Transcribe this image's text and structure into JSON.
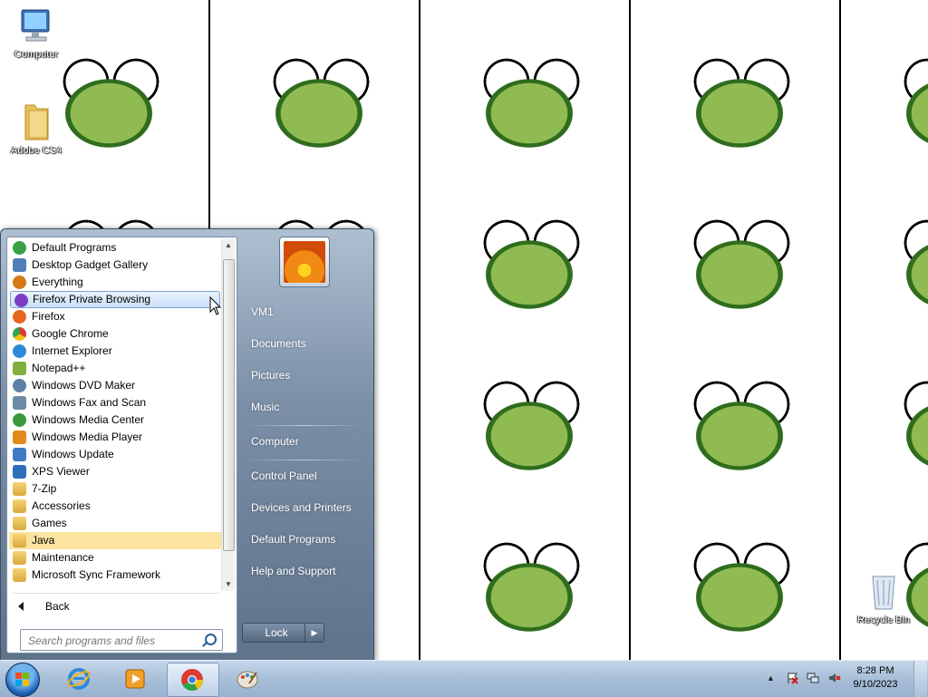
{
  "desktop": {
    "icons": [
      {
        "label": "Computer",
        "icon": "computer-icon"
      },
      {
        "label": "Adobe CS4",
        "icon": "folder-icon"
      },
      {
        "label": "Recycle Bin",
        "icon": "recycle-bin-icon"
      }
    ]
  },
  "start_menu": {
    "programs": [
      {
        "label": "Default Programs",
        "icon": "default-programs-icon",
        "color": "#3aa14a"
      },
      {
        "label": "Desktop Gadget Gallery",
        "icon": "gadget-icon",
        "color": "#4f7fb8"
      },
      {
        "label": "Everything",
        "icon": "magnifier-icon",
        "color": "#d47a16"
      },
      {
        "label": "Firefox Private Browsing",
        "icon": "firefox-private-icon",
        "color": "#7b3dc6"
      },
      {
        "label": "Firefox",
        "icon": "firefox-icon",
        "color": "#e8671e"
      },
      {
        "label": "Google Chrome",
        "icon": "chrome-icon",
        "color": "#dc3b2f"
      },
      {
        "label": "Internet Explorer",
        "icon": "ie-icon",
        "color": "#2f8ad8"
      },
      {
        "label": "Notepad++",
        "icon": "notepadpp-icon",
        "color": "#7fb03b"
      },
      {
        "label": "Windows DVD Maker",
        "icon": "dvd-maker-icon",
        "color": "#5d7fa8"
      },
      {
        "label": "Windows Fax and Scan",
        "icon": "fax-icon",
        "color": "#6c8aa6"
      },
      {
        "label": "Windows Media Center",
        "icon": "media-center-icon",
        "color": "#3a9a3a"
      },
      {
        "label": "Windows Media Player",
        "icon": "media-player-icon",
        "color": "#e28a1c"
      },
      {
        "label": "Windows Update",
        "icon": "windows-update-icon",
        "color": "#3f7bc4"
      },
      {
        "label": "XPS Viewer",
        "icon": "xps-viewer-icon",
        "color": "#2d6fb8"
      },
      {
        "label": "7-Zip",
        "icon": "folder-icon",
        "color": "#e0b34a"
      },
      {
        "label": "Accessories",
        "icon": "folder-icon",
        "color": "#e0b34a"
      },
      {
        "label": "Games",
        "icon": "folder-icon",
        "color": "#e0b34a"
      },
      {
        "label": "Java",
        "icon": "folder-icon",
        "color": "#e0b34a"
      },
      {
        "label": "Maintenance",
        "icon": "folder-icon",
        "color": "#e0b34a"
      },
      {
        "label": "Microsoft Sync Framework",
        "icon": "folder-icon",
        "color": "#e0b34a"
      }
    ],
    "hovered_item": "Firefox Private Browsing",
    "highlighted_item": "Java",
    "back_label": "Back",
    "search_placeholder": "Search programs and files",
    "right_links": [
      {
        "label": "VM1"
      },
      {
        "label": "Documents"
      },
      {
        "label": "Pictures"
      },
      {
        "label": "Music"
      },
      {
        "label": "Computer"
      },
      {
        "label": "Control Panel"
      },
      {
        "label": "Devices and Printers"
      },
      {
        "label": "Default Programs"
      },
      {
        "label": "Help and Support"
      }
    ],
    "lock_label": "Lock"
  },
  "taskbar": {
    "pinned": [
      {
        "icon": "internet-explorer-icon"
      },
      {
        "icon": "media-player-icon"
      },
      {
        "icon": "chrome-icon",
        "active": true
      },
      {
        "icon": "paint-icon"
      }
    ],
    "clock": {
      "time": "8:28 PM",
      "date": "9/10/2023"
    }
  }
}
